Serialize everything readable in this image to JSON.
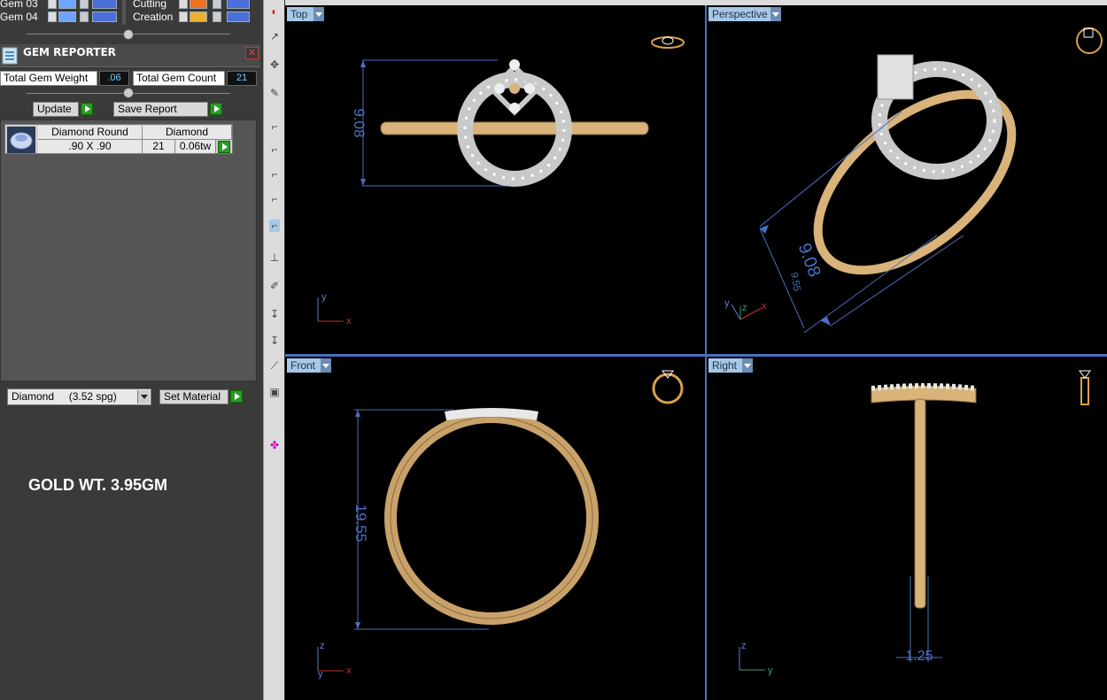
{
  "layers": [
    {
      "name": "Gem 03",
      "color": "#6ca4ff"
    },
    {
      "name": "Gem 04",
      "color": "#6ca4ff"
    },
    {
      "name": "Cutting",
      "color": "#f07020"
    },
    {
      "name": "Creation",
      "color": "#f0b030"
    }
  ],
  "gem_reporter": {
    "title": "GEM REPORTER",
    "total_weight_label": "Total Gem Weight",
    "total_weight_value": ".06",
    "total_count_label": "Total Gem Count",
    "total_count_value": "21",
    "update_label": "Update",
    "save_report_label": "Save Report",
    "table": {
      "shape": "Diamond Round",
      "size": ".90 X .90",
      "material": "Diamond",
      "count": "21",
      "weight": "0.06tw"
    }
  },
  "material": {
    "selected": "Diamond     (3.52 spg)",
    "set_label": "Set Material"
  },
  "annotation": "GOLD WT. 3.95GM",
  "viewports": {
    "top": {
      "label": "Top",
      "dimension": "9.08"
    },
    "perspective": {
      "label": "Perspective",
      "dimension_main": "9.08",
      "dimension_small": "9.55"
    },
    "front": {
      "label": "Front",
      "dimension": "19.55"
    },
    "right": {
      "label": "Right",
      "dimension": "1.25"
    }
  },
  "axes": {
    "x": "x",
    "y": "y",
    "z": "z"
  },
  "colors": {
    "viewport_bg": "#000000",
    "dimension_line": "#4a6fc0",
    "gold": "#d9b37a",
    "label_bg": "#a7c7e7"
  }
}
